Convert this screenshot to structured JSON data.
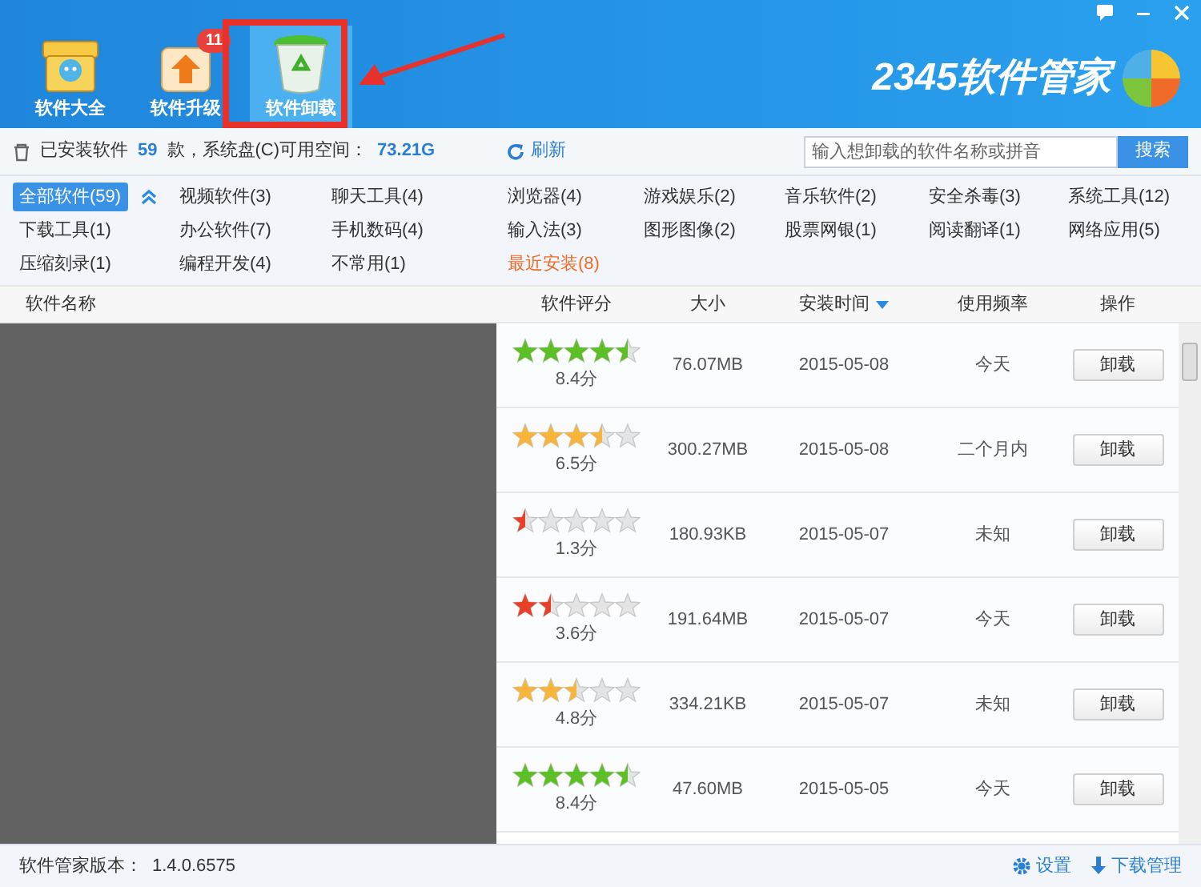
{
  "nav_tabs": [
    {
      "label": "软件大全",
      "selected": false,
      "kind": "box"
    },
    {
      "label": "软件升级",
      "selected": false,
      "kind": "upgrade",
      "badge": "11"
    },
    {
      "label": "软件卸载",
      "selected": true,
      "kind": "bin"
    }
  ],
  "brand": "2345软件管家",
  "toolbar": {
    "installed_prefix": "已安装软件",
    "installed_count": "59",
    "installed_suffix": "款，系统盘(C)可用空间：",
    "free_space": "73.21G",
    "refresh": "刷新",
    "search_placeholder": "输入想卸载的软件名称或拼音",
    "search_button": "搜索"
  },
  "categories": [
    {
      "label": "全部软件(59)",
      "selected": true,
      "highlight": false
    },
    {
      "label": "视频软件(3)",
      "selected": false,
      "highlight": false
    },
    {
      "label": "聊天工具(4)",
      "selected": false,
      "highlight": false
    },
    {
      "label": "浏览器(4)",
      "selected": false,
      "highlight": false
    },
    {
      "label": "游戏娱乐(2)",
      "selected": false,
      "highlight": false
    },
    {
      "label": "音乐软件(2)",
      "selected": false,
      "highlight": false
    },
    {
      "label": "安全杀毒(3)",
      "selected": false,
      "highlight": false
    },
    {
      "label": "系统工具(12)",
      "selected": false,
      "highlight": false
    },
    {
      "label": "下载工具(1)",
      "selected": false,
      "highlight": false
    },
    {
      "label": "办公软件(7)",
      "selected": false,
      "highlight": false
    },
    {
      "label": "手机数码(4)",
      "selected": false,
      "highlight": false
    },
    {
      "label": "输入法(3)",
      "selected": false,
      "highlight": false
    },
    {
      "label": "图形图像(2)",
      "selected": false,
      "highlight": false
    },
    {
      "label": "股票网银(1)",
      "selected": false,
      "highlight": false
    },
    {
      "label": "阅读翻译(1)",
      "selected": false,
      "highlight": false
    },
    {
      "label": "网络应用(5)",
      "selected": false,
      "highlight": false
    },
    {
      "label": "压缩刻录(1)",
      "selected": false,
      "highlight": false
    },
    {
      "label": "编程开发(4)",
      "selected": false,
      "highlight": false
    },
    {
      "label": "不常用(1)",
      "selected": false,
      "highlight": false
    },
    {
      "label": "最近安装(8)",
      "selected": false,
      "highlight": true
    }
  ],
  "columns": [
    "软件名称",
    "软件评分",
    "大小",
    "安装时间",
    "使用频率",
    "操作"
  ],
  "rows": [
    {
      "stars": 4.5,
      "score": "8.4分",
      "size": "76.07MB",
      "date": "2015-05-08",
      "usage": "今天",
      "action": "卸载"
    },
    {
      "stars": 3.5,
      "score": "6.5分",
      "size": "300.27MB",
      "date": "2015-05-08",
      "usage": "二个月内",
      "action": "卸载"
    },
    {
      "stars": 0.5,
      "score": "1.3分",
      "size": "180.93KB",
      "date": "2015-05-07",
      "usage": "未知",
      "action": "卸载"
    },
    {
      "stars": 1.5,
      "score": "3.6分",
      "size": "191.64MB",
      "date": "2015-05-07",
      "usage": "今天",
      "action": "卸载"
    },
    {
      "stars": 2.5,
      "score": "4.8分",
      "size": "334.21KB",
      "date": "2015-05-07",
      "usage": "未知",
      "action": "卸载"
    },
    {
      "stars": 4.5,
      "score": "8.4分",
      "size": "47.60MB",
      "date": "2015-05-05",
      "usage": "今天",
      "action": "卸载"
    }
  ],
  "status_bar": {
    "version_label": "软件管家版本：",
    "version": "1.4.0.6575",
    "settings": "设置",
    "downloads": "下载管理"
  }
}
